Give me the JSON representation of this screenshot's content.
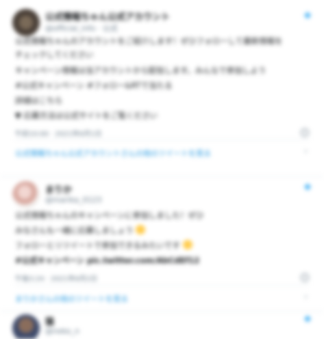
{
  "tweets": [
    {
      "name": "公式情報ちゃん公式アカウント",
      "handle": "@official_info · 公式",
      "lines": [
        "公式情報ちゃんのアカウントをご紹介します！ぜひフォローして最新情報を",
        "チェックしてください",
        "キャンペーン情報は当アカウントから配信します。みんなで参加しよう",
        "#公式キャンペーン #フォロー&RTで当たる",
        "詳細はこちら",
        "▼ 応募方法は公式サイトをご覧ください"
      ],
      "meta": "午前10:00 · 2021年6月1日",
      "more": "公式情報ちゃん公式アカウントさんの他のツイートを見る"
    },
    {
      "name": "まりか",
      "handle": "@marika_0123",
      "lines": [
        "公式情報ちゃんのキャンペーンに参加しました！ぜひ",
        "みなさんも一緒に応募しましょう",
        "フォローとリツイートで参加できるみたいです",
        "#公式キャンペーン pic.twitter.com/AbCdEf12"
      ],
      "meta": "午後3:24 · 2021年6月2日",
      "more": "まりかさんの他のツイートを見る"
    },
    {
      "name": "猫",
      "handle": "@neko_n"
    }
  ],
  "icons": {
    "bird": "twitter-bird-icon",
    "info": "info-icon",
    "chevron": "chevron-right-icon"
  },
  "colors": {
    "accent": "#1da1f2",
    "link": "#1b95e0",
    "muted": "#657786",
    "border": "#e6ecf0"
  }
}
